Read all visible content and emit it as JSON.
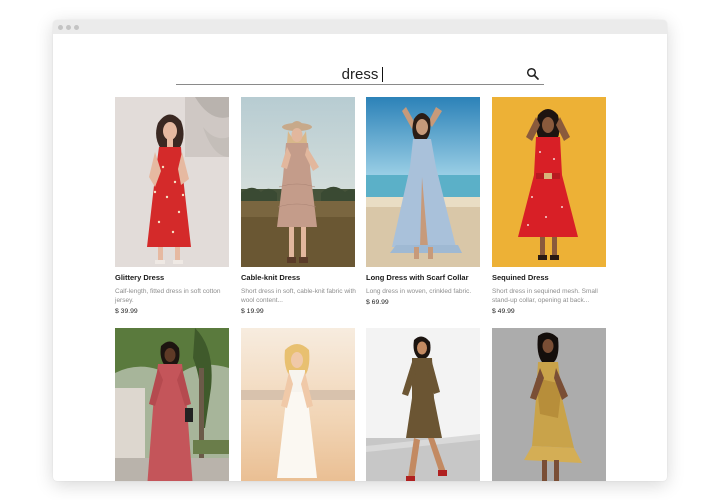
{
  "search": {
    "query": "dress"
  },
  "icons": {
    "search": "search-icon"
  },
  "products": [
    {
      "name": "Glittery Dress",
      "description": "Calf-length, fitted dress in soft cotton jersey.",
      "price": "$ 39.99"
    },
    {
      "name": "Cable-knit Dress",
      "description": "Short dress in soft, cable-knit fabric with wool content...",
      "price": "$ 19.99"
    },
    {
      "name": "Long Dress with Scarf Collar",
      "description": "Long dress in woven, crinkled fabric.",
      "price": "$ 69.99"
    },
    {
      "name": "Sequined Dress",
      "description": "Short dress in sequined mesh. Small stand-up collar, opening at back...",
      "price": "$ 49.99"
    },
    {
      "name": "",
      "description": "",
      "price": ""
    },
    {
      "name": "",
      "description": "",
      "price": ""
    },
    {
      "name": "",
      "description": "",
      "price": ""
    },
    {
      "name": "",
      "description": "",
      "price": ""
    }
  ],
  "colors": {
    "window_shadow": "#000000",
    "titlebar": "#ebebeb",
    "text_primary": "#1a1a1a",
    "text_secondary": "#8e8e8e"
  }
}
